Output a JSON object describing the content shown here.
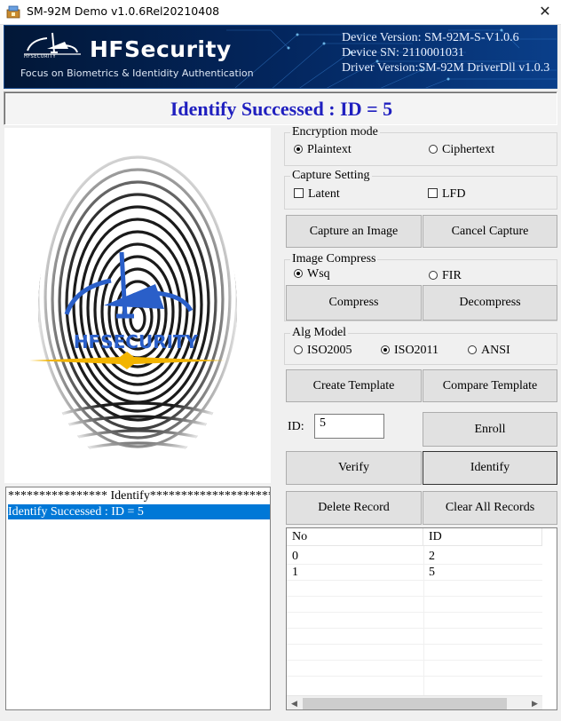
{
  "window": {
    "title": "SM-92M Demo v1.0.6Rel20210408",
    "close_glyph": "✕"
  },
  "banner": {
    "brand": "HFSecurity",
    "tagline": "Focus on Biometrics & Identidity Authentication",
    "logo_text": "HFSECURITY",
    "device_version": "Device Version: SM-92M-S-V1.0.6",
    "device_sn": "Device SN: 2110001031",
    "driver_version": "Driver Version:SM-92M DriverDll v1.0.3"
  },
  "status": {
    "message": "Identify Successed : ID = 5"
  },
  "fingerprint": {
    "watermark": "HFSECURITY"
  },
  "log": {
    "lines": [
      "**************** Identify********************",
      "Identify Successed : ID = 5"
    ]
  },
  "encryption": {
    "title": "Encryption mode",
    "plaintext": "Plaintext",
    "ciphertext": "Ciphertext",
    "selected": "Plaintext"
  },
  "capture_setting": {
    "title": "Capture Setting",
    "latent": "Latent",
    "lfd": "LFD"
  },
  "buttons": {
    "capture": "Capture an Image",
    "cancel_capture": "Cancel Capture",
    "compress": "Compress",
    "decompress": "Decompress",
    "create_template": "Create Template",
    "compare_template": "Compare Template",
    "enroll": "Enroll",
    "verify": "Verify",
    "identify": "Identify",
    "delete_record": "Delete Record",
    "clear_all": "Clear All Records"
  },
  "image_compress": {
    "title": "Image Compress",
    "wsq": "Wsq",
    "fir": "FIR",
    "selected": "Wsq"
  },
  "alg_model": {
    "title": "Alg Model",
    "iso2005": "ISO2005",
    "iso2011": "ISO2011",
    "ansi": "ANSI",
    "selected": "ISO2011"
  },
  "id_field": {
    "label": "ID:",
    "value": "5"
  },
  "records": {
    "columns": [
      "No",
      "ID"
    ],
    "rows": [
      {
        "no": "0",
        "id": "2"
      },
      {
        "no": "1",
        "id": "5"
      }
    ]
  },
  "colors": {
    "status_text": "#1f1fbf",
    "banner_bg": "#021b44",
    "selection": "#0078d7",
    "logo_blue": "#2a5fc9",
    "logo_gold": "#f2b400"
  }
}
